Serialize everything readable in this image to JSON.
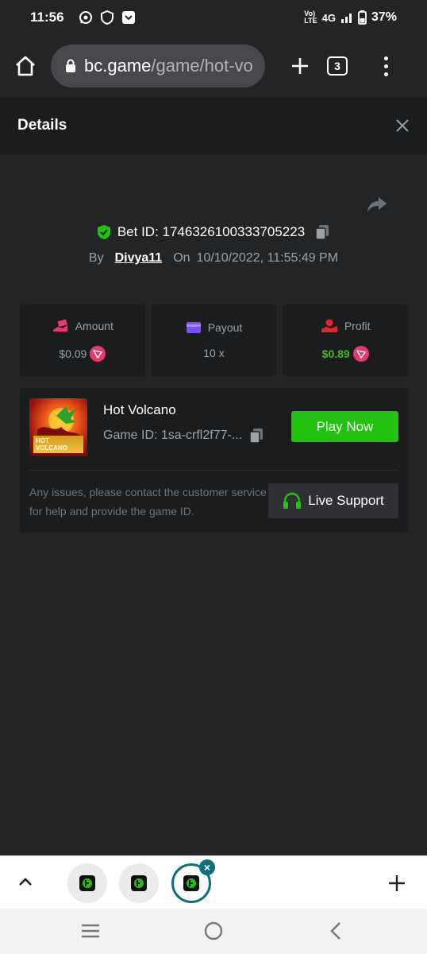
{
  "status": {
    "time": "11:56",
    "network_top": "Vo)",
    "network_bottom": "LTE",
    "signal_label": "4G",
    "battery": "37%",
    "left_icons": [
      "whatsapp-icon",
      "shield-icon",
      "message-icon"
    ]
  },
  "browser": {
    "url_host": "bc.game",
    "url_path": "/game/hot-vo",
    "tab_count": "3"
  },
  "details": {
    "title": "Details"
  },
  "bet": {
    "label": "Bet ID: 1746326100333705223",
    "by_label": "By",
    "user": "Divya11",
    "on_label": "On",
    "date": "10/10/2022, 11:55:49 PM"
  },
  "stats": [
    {
      "label": "Amount",
      "value": "$0.09",
      "icon": "money-hand-icon",
      "accent": "#e8386d"
    },
    {
      "label": "Payout",
      "value": "10 x",
      "icon": "wallet-icon",
      "accent": "#7b4ff5"
    },
    {
      "label": "Profit",
      "value": "$0.89",
      "icon": "hand-coin-icon",
      "accent": "#e8232b"
    }
  ],
  "game": {
    "name": "Hot Volcano",
    "game_id": "Game ID: 1sa-crfl2f77-...",
    "thumb_text_1": "HOT",
    "thumb_text_2": "VOLCANO",
    "play_label": "Play Now",
    "issues_text": "Any issues, please contact the customer service for help and provide the game ID.",
    "support_label": "Live Support"
  },
  "colors": {
    "accent_green": "#21c30f",
    "profit_green": "#3bc117",
    "bg": "#232426",
    "panel": "#1b1c1e"
  }
}
